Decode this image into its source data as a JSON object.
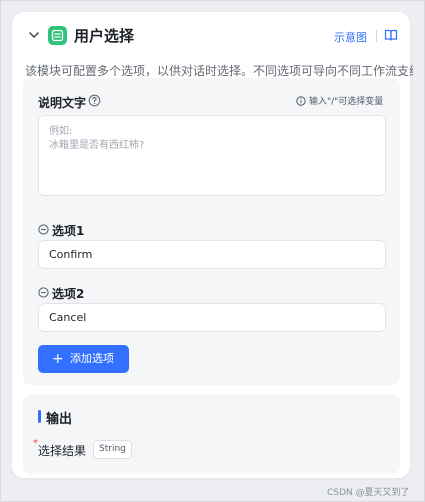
{
  "header": {
    "title": "用户选择",
    "schema_link": "示意图",
    "icons": [
      "chevron-down-icon",
      "app-icon",
      "book-icon"
    ]
  },
  "description": "该模块可配置多个选项，以供对话时选择。不同选项可导向不同工作流支线",
  "prompt_section": {
    "label": "说明文字",
    "hint": "输入\"/\"可选择变量",
    "textarea_placeholder_line1": "例如:",
    "textarea_placeholder_line2": "冰箱里是否有西红柿?"
  },
  "options": [
    {
      "label": "选项1",
      "value": "Confirm"
    },
    {
      "label": "选项2",
      "value": "Cancel"
    }
  ],
  "add_button": {
    "label": "添加选项",
    "icon": "+"
  },
  "output": {
    "title": "输出",
    "field_name": "选择结果",
    "field_type": "String",
    "required_marker": "*"
  },
  "watermark": "CSDN @夏天又到了",
  "colors": {
    "accent": "#3370ff",
    "app_icon": "#2fc27a",
    "required": "#f54a45"
  }
}
